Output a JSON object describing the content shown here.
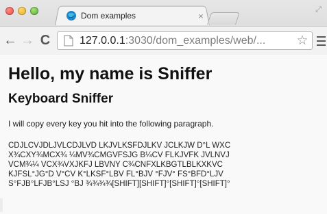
{
  "window": {
    "tab_title": "Dom examples",
    "tab_close": "×",
    "resize_glyph": "⤢"
  },
  "toolbar": {
    "back_glyph": "←",
    "forward_glyph": "→",
    "reload_glyph": "C",
    "url_host": "127.0.0.1",
    "url_path": ":3030/dom_examples/web/...",
    "bookmark_glyph": "☆"
  },
  "page": {
    "heading": "Hello, my name is Sniffer",
    "subheading": "Keyboard Sniffer",
    "intro": "I will copy every key you hit into the following paragraph.",
    "typed_lines": [
      "CDJLCVJDLJVLCDJLVD LKJVLKSFDJLKV JCLKJW D°L WXC",
      "X¾CXY¾MCX¾ ¼MV¾CMGVFSJG B¼CV FLKJVFK JVLNVJ",
      "VCM¾¼ VCX¾VXJKFJ LBVNY C¾CNFXLKBGTLBLKXKVC",
      "KJFSL°JG°D V°CV K°LKSF°LBV FL°BJV °FJV° FS°BFD°LJV",
      "S°FJB°LFJB°LSJ °BJ ¾¾¾¾[SHIFT][SHIFT]°[SHIFT]°[SHIFT]°"
    ]
  },
  "colors": {
    "close_light": "#e9443a",
    "min_light": "#e8a91f",
    "max_light": "#4ea82f",
    "url_path": "#7d7d7d"
  },
  "icons": [
    "traffic-lights",
    "favicon-globe",
    "tab-close-icon",
    "back-arrow-icon",
    "forward-arrow-icon",
    "reload-icon",
    "page-icon",
    "star-icon",
    "menu-icon",
    "fullscreen-icon"
  ]
}
